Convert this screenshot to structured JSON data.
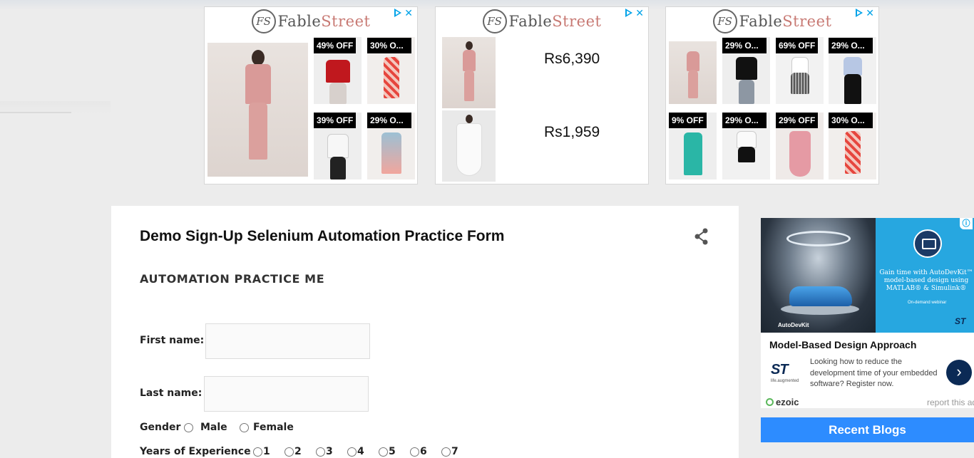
{
  "ads": {
    "brand_prefix": "Fable",
    "brand_suffix": "Street",
    "brand_mark": "FS",
    "ad1_badges": [
      "49% OFF",
      "30% O...",
      "39% OFF",
      "29% O..."
    ],
    "ad2_prices": [
      "Rs6,390",
      "Rs1,959"
    ],
    "ad3_badges": [
      "29% O...",
      "69% OFF",
      "29% O...",
      "9% OFF",
      "29% O...",
      "29% OFF",
      "30% O..."
    ]
  },
  "form": {
    "title": "Demo Sign-Up Selenium Automation Practice Form",
    "subtitle": "AUTOMATION PRACTICE ME",
    "first_name_label": "First name:",
    "last_name_label": "Last name:",
    "first_name_value": "",
    "last_name_value": "",
    "gender_label": "Gender",
    "gender_options": [
      "Male",
      "Female"
    ],
    "experience_label": "Years of Experience",
    "experience_options": [
      "1",
      "2",
      "3",
      "4",
      "5",
      "6",
      "7"
    ]
  },
  "side_ad": {
    "hero_text": "Gain time with AutoDevKit™ model-based design using MATLAB® & Simulink®",
    "hero_small": "On-demand webinar",
    "hero_brand": "AutoDevKit",
    "title": "Model-Based Design Approach",
    "description": "Looking how to reduce the development time of your embedded software? Register now.",
    "st_tag": "life.augmented",
    "ezoic": "ezoic",
    "report": "report this ad"
  },
  "recent_blogs": "Recent Blogs",
  "colors": {
    "accent_blue": "#2d8cff",
    "adchoices_blue": "#00a2e8",
    "st_navy": "#0b2a55"
  }
}
